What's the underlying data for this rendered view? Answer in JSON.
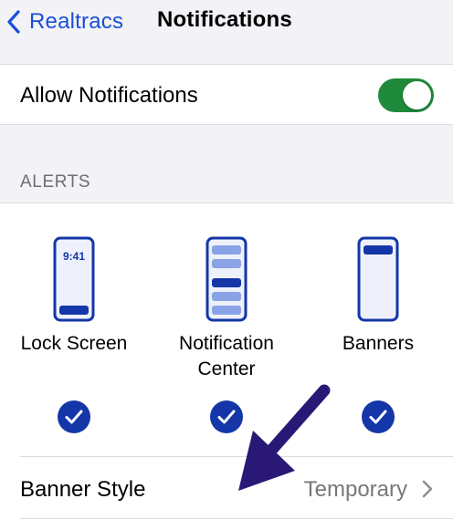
{
  "nav": {
    "back_label": "Realtracs",
    "title": "Notifications"
  },
  "allow": {
    "label": "Allow Notifications",
    "enabled": true
  },
  "alerts": {
    "header": "ALERTS",
    "options": [
      {
        "label": "Lock Screen",
        "icon": "lock-screen-phone-icon",
        "checked": true
      },
      {
        "label": "Notification Center",
        "icon": "notification-center-phone-icon",
        "checked": true
      },
      {
        "label": "Banners",
        "icon": "banners-phone-icon",
        "checked": true
      }
    ],
    "lock_time": "9:41"
  },
  "banner_style": {
    "label": "Banner Style",
    "value": "Temporary"
  },
  "colors": {
    "accent": "#1a4fd6",
    "toggle_on": "#1f8a3b",
    "check": "#1436a8",
    "arrow": "#2a1877"
  }
}
